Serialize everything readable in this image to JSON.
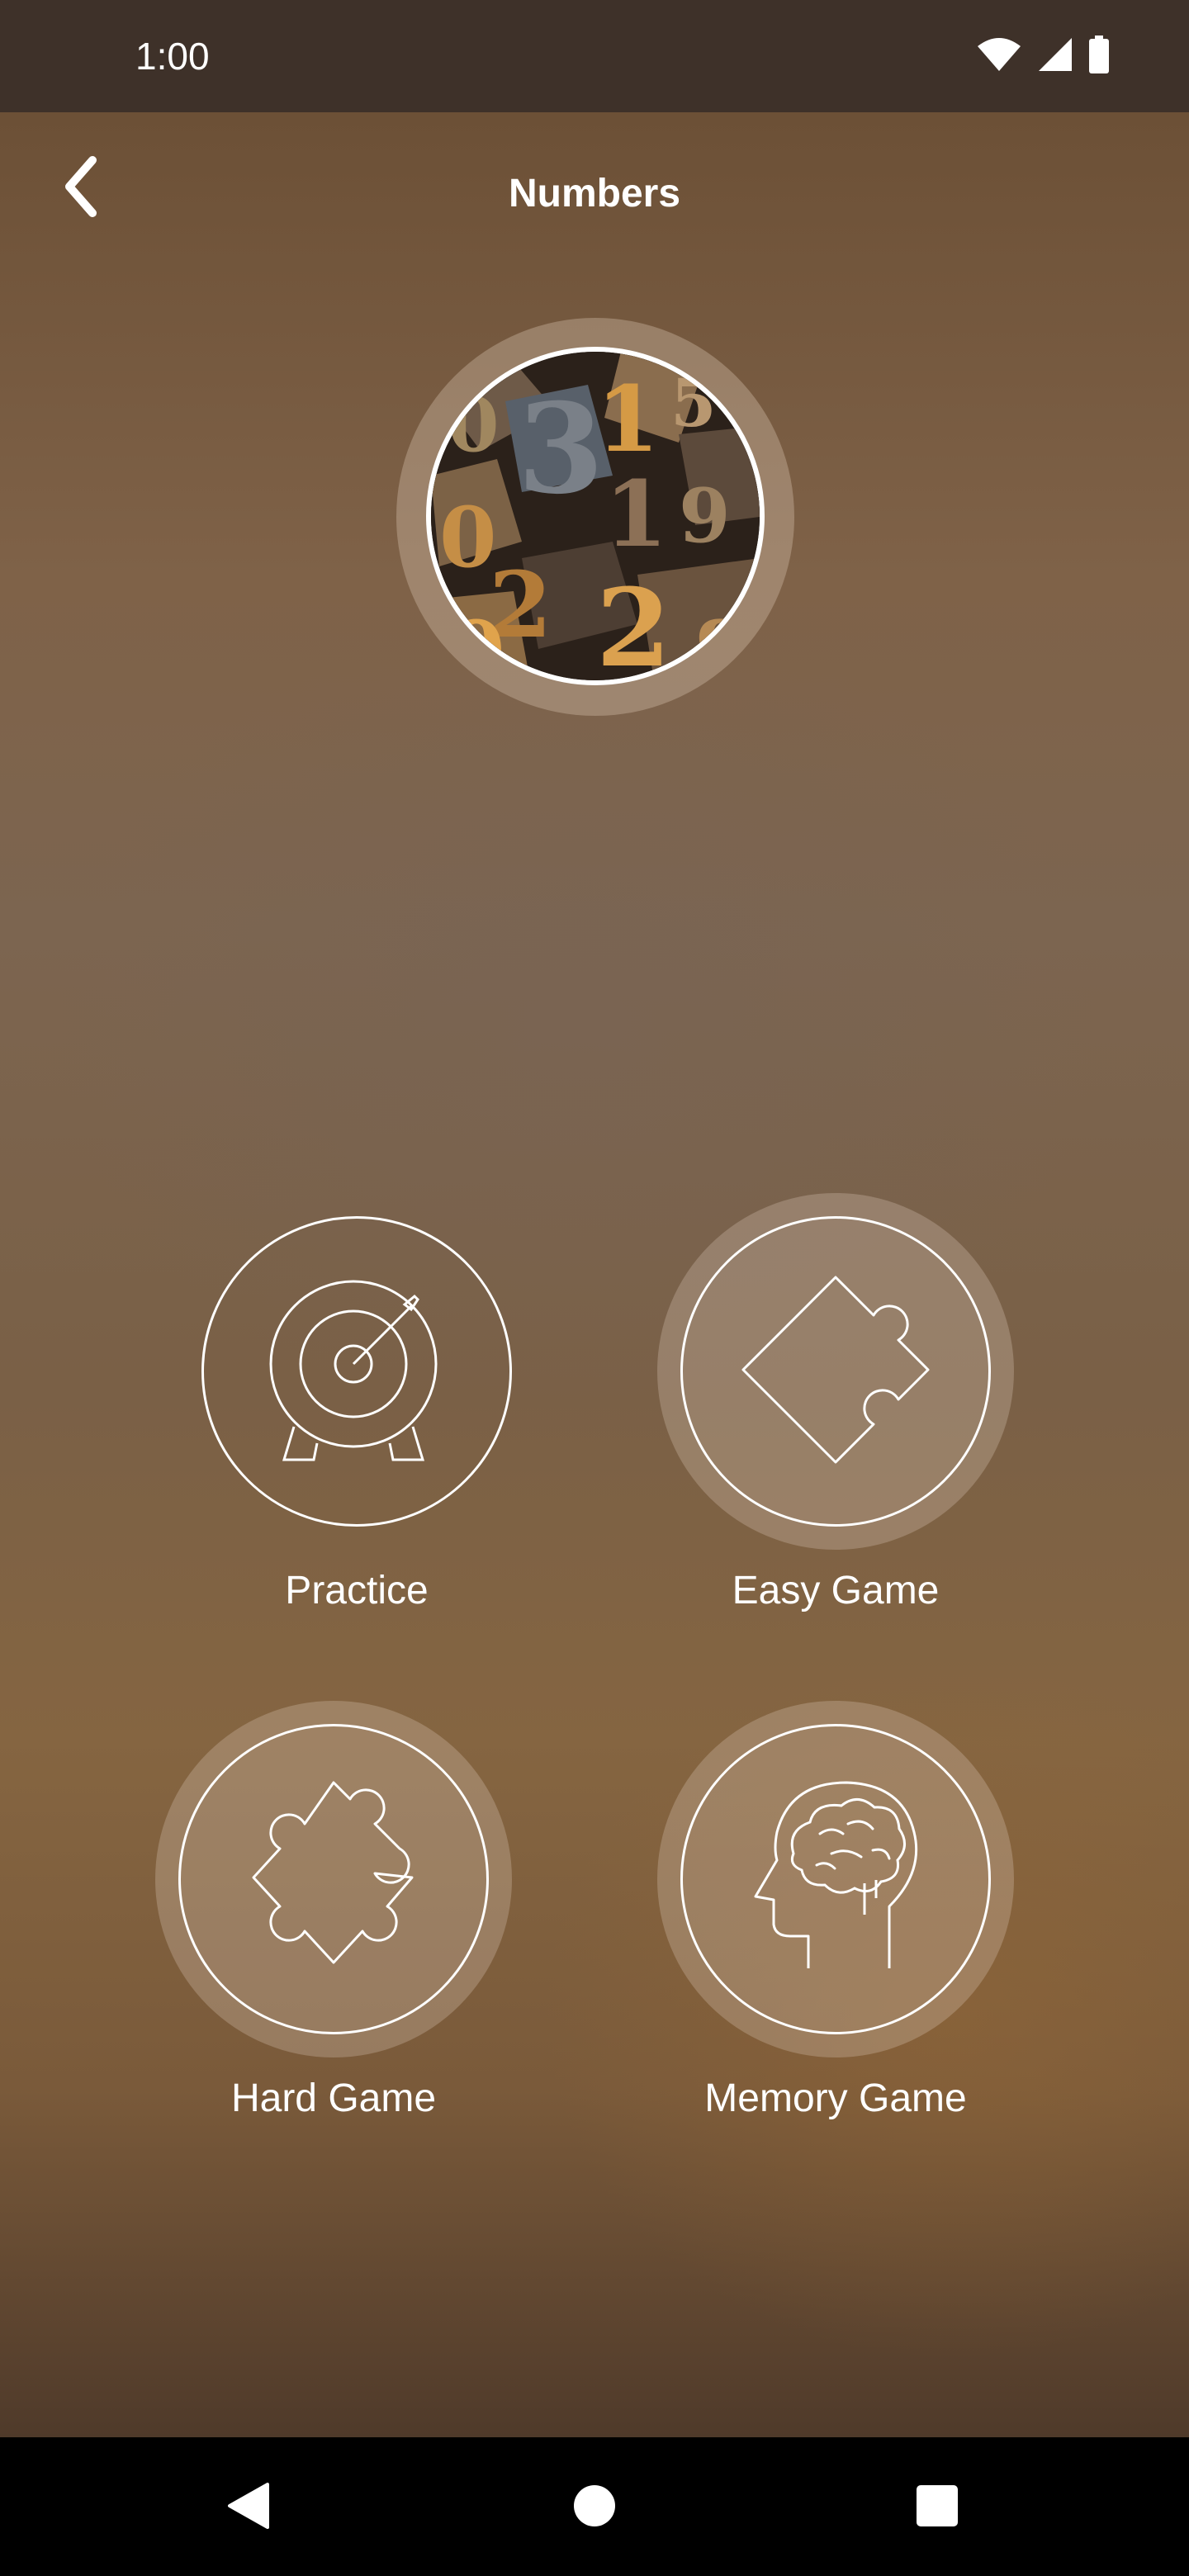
{
  "status_bar": {
    "time": "1:00",
    "icons": [
      "wifi-icon",
      "signal-icon",
      "battery-icon"
    ]
  },
  "header": {
    "title": "Numbers",
    "back_icon": "chevron-left-icon"
  },
  "hero": {
    "image": "wooden-letterpress-numbers"
  },
  "menu": {
    "items": [
      {
        "label": "Practice",
        "icon": "target-icon"
      },
      {
        "label": "Easy Game",
        "icon": "puzzle-piece-icon"
      },
      {
        "label": "Hard Game",
        "icon": "puzzle-piece-icon"
      },
      {
        "label": "Memory Game",
        "icon": "brain-head-icon"
      }
    ]
  },
  "nav_bar": {
    "buttons": [
      "back-triangle-icon",
      "home-circle-icon",
      "recents-square-icon"
    ]
  },
  "colors": {
    "status_bar": "#3e3129",
    "background_top": "#6c5036",
    "background_bottom": "#4f3a2a",
    "foreground": "#ffffff",
    "nav_bar": "#000000"
  }
}
